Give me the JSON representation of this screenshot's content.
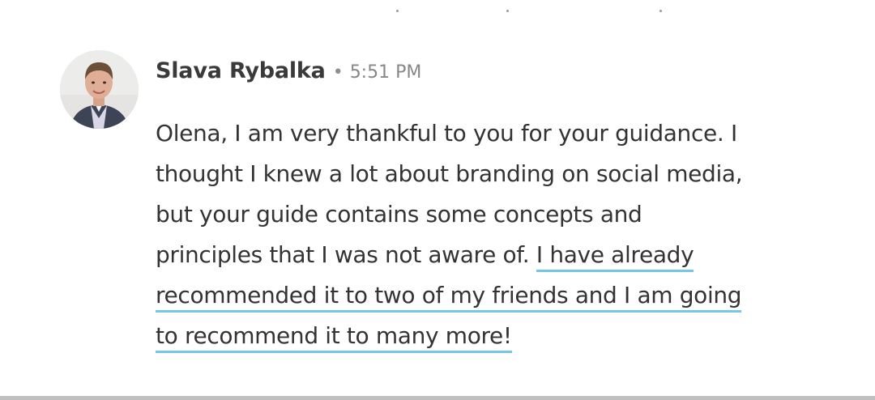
{
  "message": {
    "author": "Slava Rybalka",
    "separator": "•",
    "timestamp": "5:51 PM",
    "lines": [
      {
        "plain": "Olena, I am very thankful to you for your guidance. I",
        "highlight": ""
      },
      {
        "plain": "thought I knew a lot about branding on social media,",
        "highlight": ""
      },
      {
        "plain": "but your guide contains some concepts and",
        "highlight": ""
      },
      {
        "plain": "principles that I was not aware of. ",
        "highlight": "I have already"
      },
      {
        "plain": "",
        "highlight": "recommended it to two of my friends and I am going"
      },
      {
        "plain": "",
        "highlight": "to recommend it to many more!"
      }
    ]
  },
  "colors": {
    "highlight_underline": "#74c7e8",
    "author_text": "#3a3a3a",
    "timestamp_text": "#878787",
    "body_text": "#333333"
  }
}
